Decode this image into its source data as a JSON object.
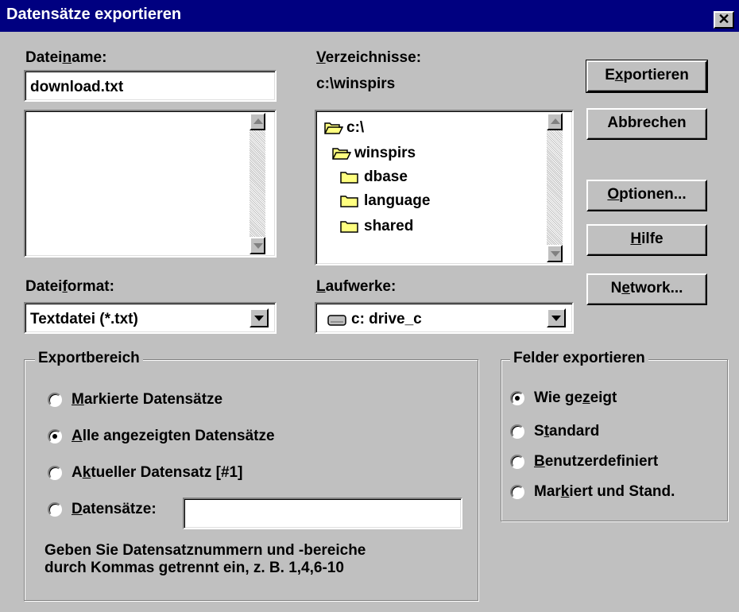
{
  "window": {
    "title": "Datensätze exportieren",
    "close_glyph": "✕"
  },
  "filename": {
    "label_pre": "Datei",
    "label_ul": "n",
    "label_post": "ame:",
    "value": "download.txt"
  },
  "directories": {
    "label_ul": "V",
    "label_post": "erzeichnisse:",
    "current_path": "c:\\winspirs",
    "tree": [
      {
        "name": "c:\\",
        "open": true
      },
      {
        "name": "winspirs",
        "open": true
      },
      {
        "name": "dbase",
        "open": false
      },
      {
        "name": "language",
        "open": false
      },
      {
        "name": "shared",
        "open": false
      }
    ]
  },
  "file_format": {
    "label_pre": "Datei",
    "label_ul": "f",
    "label_post": "ormat:",
    "value": "Textdatei (*.txt)"
  },
  "drives": {
    "label_ul": "L",
    "label_post": "aufwerke:",
    "value": "c: drive_c"
  },
  "buttons": {
    "export_pre": "E",
    "export_ul": "x",
    "export_post": "portieren",
    "cancel": "Abbrechen",
    "options_ul": "O",
    "options_post": "ptionen...",
    "help_ul": "H",
    "help_post": "ilfe",
    "network_pre": "N",
    "network_ul": "e",
    "network_post": "twork..."
  },
  "export_range": {
    "legend": "Exportbereich",
    "options": [
      {
        "pre": "",
        "ul": "M",
        "post": "arkierte Datensätze",
        "selected": false
      },
      {
        "pre": "",
        "ul": "A",
        "post": "lle angezeigten Datensätze",
        "selected": true
      },
      {
        "pre": "A",
        "ul": "k",
        "post": "tueller Datensatz [#1]",
        "selected": false
      },
      {
        "pre": "",
        "ul": "D",
        "post": "atensätze:",
        "selected": false
      }
    ],
    "records_value": "",
    "hint_line1": "Geben Sie Datensatznummern und -bereiche",
    "hint_line2": "durch Kommas getrennt ein, z. B. 1,4,6-10"
  },
  "export_fields": {
    "legend": "Felder exportieren",
    "options": [
      {
        "pre": "Wie ge",
        "ul": "z",
        "post": "eigt",
        "selected": true
      },
      {
        "pre": "S",
        "ul": "t",
        "post": "andard",
        "selected": false
      },
      {
        "pre": "",
        "ul": "B",
        "post": "enutzerdefiniert",
        "selected": false
      },
      {
        "pre": "Mar",
        "ul": "k",
        "post": "iert und Stand.",
        "selected": false
      }
    ]
  }
}
